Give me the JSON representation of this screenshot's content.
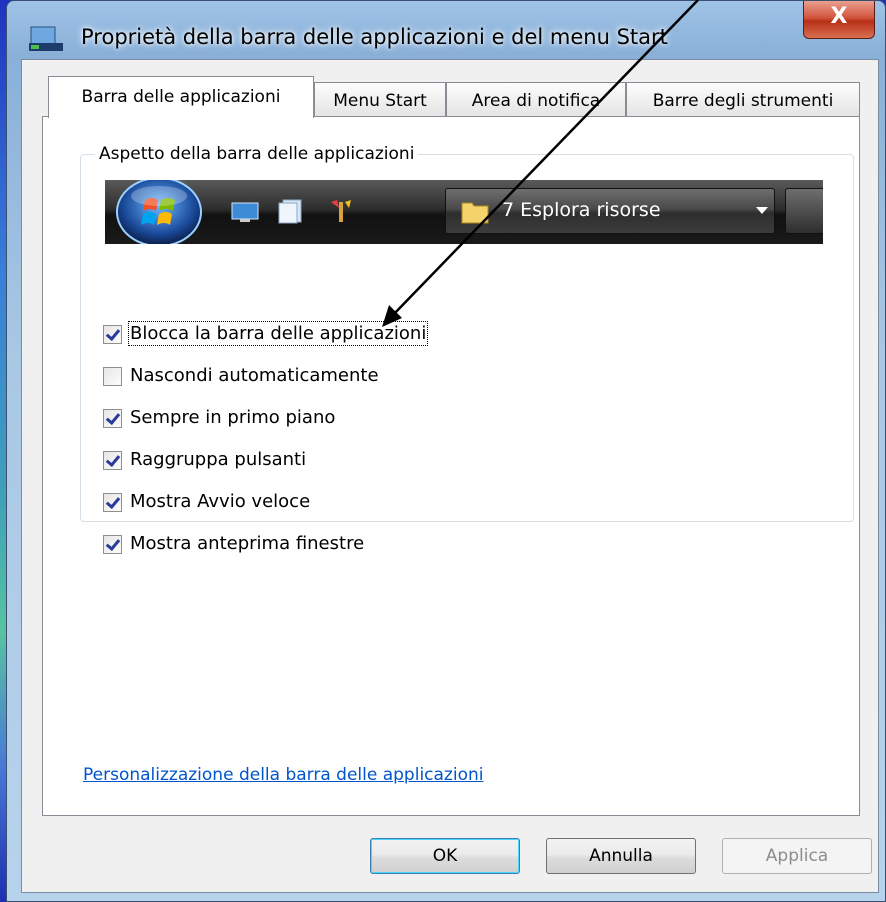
{
  "window": {
    "title": "Proprietà della barra delle applicazioni e del menu Start",
    "close_label": "X"
  },
  "tabs": [
    {
      "label": "Barra delle applicazioni",
      "active": true
    },
    {
      "label": "Menu Start",
      "active": false
    },
    {
      "label": "Area di notifica",
      "active": false
    },
    {
      "label": "Barre degli strumenti",
      "active": false
    }
  ],
  "appearance": {
    "group_label": "Aspetto della barra delle applicazioni",
    "taskbar_button_label": "7 Esplora risorse",
    "options": [
      {
        "label": "Blocca la barra delle applicazioni",
        "checked": true
      },
      {
        "label": "Nascondi automaticamente",
        "checked": false
      },
      {
        "label": "Sempre in primo piano",
        "checked": true
      },
      {
        "label": "Raggruppa pulsanti",
        "checked": true
      },
      {
        "label": "Mostra Avvio veloce",
        "checked": true
      },
      {
        "label": "Mostra anteprima finestre",
        "checked": true
      }
    ]
  },
  "link": {
    "label": "Personalizzazione della barra delle applicazioni"
  },
  "buttons": {
    "ok": "OK",
    "cancel": "Annulla",
    "apply": "Applica"
  }
}
